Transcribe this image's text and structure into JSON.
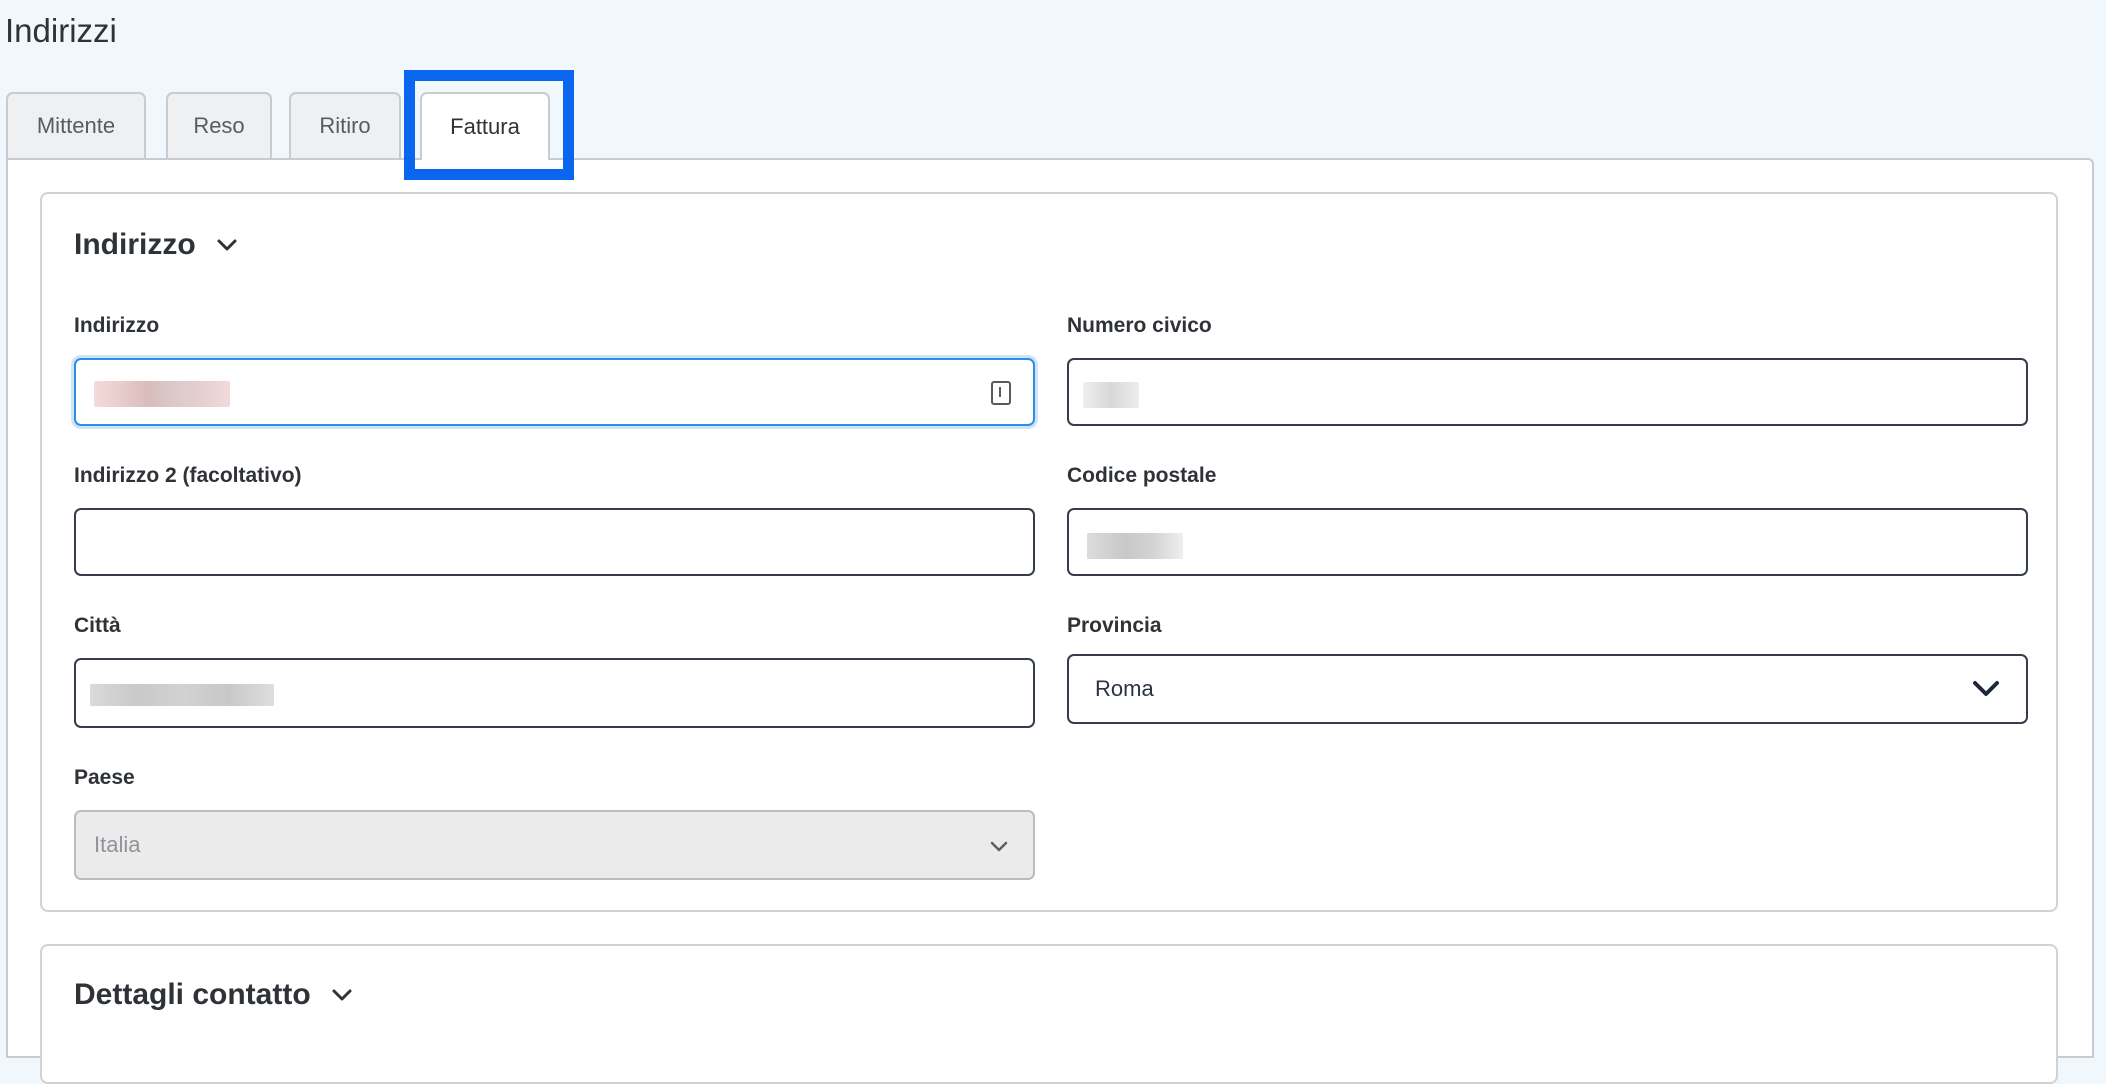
{
  "page": {
    "title": "Indirizzi"
  },
  "tabs": [
    {
      "label": "Mittente",
      "active": false
    },
    {
      "label": "Reso",
      "active": false
    },
    {
      "label": "Ritiro",
      "active": false
    },
    {
      "label": "Fattura",
      "active": true
    }
  ],
  "address_section": {
    "title": "Indirizzo",
    "fields": {
      "indirizzo": {
        "label": "Indirizzo",
        "value": ""
      },
      "numero_civico": {
        "label": "Numero civico",
        "value": ""
      },
      "indirizzo2": {
        "label": "Indirizzo 2 (facoltativo)",
        "value": ""
      },
      "codice_postale": {
        "label": "Codice postale",
        "value": ""
      },
      "citta": {
        "label": "Città",
        "value": ""
      },
      "provincia": {
        "label": "Provincia",
        "value": "Roma"
      },
      "paese": {
        "label": "Paese",
        "value": "Italia",
        "disabled": true
      }
    }
  },
  "contact_section": {
    "title": "Dettagli contatto"
  },
  "colors": {
    "highlight": "#0a66ee",
    "focus_border": "#2f8de4",
    "field_border": "#353c4a",
    "page_background": "#f0f7fd"
  }
}
